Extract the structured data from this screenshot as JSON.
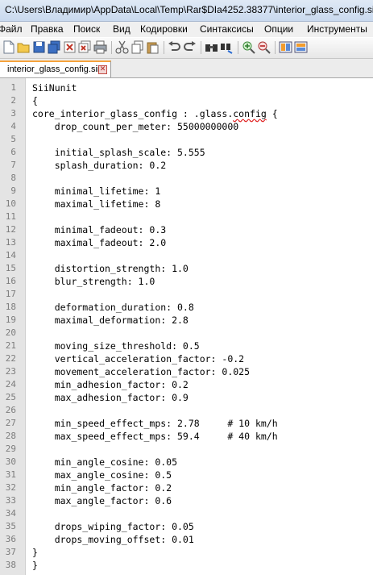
{
  "window": {
    "title": "C:\\Users\\Владимир\\AppData\\Local\\Temp\\Rar$DIa4252.38377\\interior_glass_config.sii"
  },
  "menu": [
    "Файл",
    "Правка",
    "Поиск",
    "Вид",
    "Кодировки",
    "Синтаксисы",
    "Опции",
    "Инструменты"
  ],
  "toolbar": {
    "icons": [
      "new-file-icon",
      "open-file-icon",
      "save-icon",
      "save-all-icon",
      "close-icon",
      "close-all-icon",
      "print-icon",
      "cut-icon",
      "copy-icon",
      "paste-icon",
      "undo-icon",
      "redo-icon",
      "find-icon",
      "replace-icon",
      "zoom-in-icon",
      "zoom-out-icon",
      "sync-v-icon",
      "sync-h-icon"
    ]
  },
  "tab": {
    "label": "interior_glass_config.sii",
    "close_glyph": "✕"
  },
  "editor": {
    "lines": [
      {
        "n": "1",
        "text": "SiiNunit"
      },
      {
        "n": "2",
        "text": "{"
      },
      {
        "n": "3",
        "text": "core_interior_glass_config : .glass.config {"
      },
      {
        "n": "4",
        "text": "    drop_count_per_meter: 55000000000"
      },
      {
        "n": "5",
        "text": ""
      },
      {
        "n": "6",
        "text": "    initial_splash_scale: 5.555"
      },
      {
        "n": "7",
        "text": "    splash_duration: 0.2"
      },
      {
        "n": "8",
        "text": ""
      },
      {
        "n": "9",
        "text": "    minimal_lifetime: 1"
      },
      {
        "n": "10",
        "text": "    maximal_lifetime: 8"
      },
      {
        "n": "11",
        "text": ""
      },
      {
        "n": "12",
        "text": "    minimal_fadeout: 0.3"
      },
      {
        "n": "13",
        "text": "    maximal_fadeout: 2.0"
      },
      {
        "n": "14",
        "text": ""
      },
      {
        "n": "15",
        "text": "    distortion_strength: 1.0"
      },
      {
        "n": "16",
        "text": "    blur_strength: 1.0"
      },
      {
        "n": "17",
        "text": ""
      },
      {
        "n": "18",
        "text": "    deformation_duration: 0.8"
      },
      {
        "n": "19",
        "text": "    maximal_deformation: 2.8"
      },
      {
        "n": "20",
        "text": ""
      },
      {
        "n": "21",
        "text": "    moving_size_threshold: 0.5"
      },
      {
        "n": "22",
        "text": "    vertical_acceleration_factor: -0.2"
      },
      {
        "n": "23",
        "text": "    movement_acceleration_factor: 0.025"
      },
      {
        "n": "24",
        "text": "    min_adhesion_factor: 0.2"
      },
      {
        "n": "25",
        "text": "    max_adhesion_factor: 0.9"
      },
      {
        "n": "26",
        "text": ""
      },
      {
        "n": "27",
        "text": "    min_speed_effect_mps: 2.78     # 10 km/h"
      },
      {
        "n": "28",
        "text": "    max_speed_effect_mps: 59.4     # 40 km/h"
      },
      {
        "n": "29",
        "text": ""
      },
      {
        "n": "30",
        "text": "    min_angle_cosine: 0.05"
      },
      {
        "n": "31",
        "text": "    max_angle_cosine: 0.5"
      },
      {
        "n": "32",
        "text": "    min_angle_factor: 0.2"
      },
      {
        "n": "33",
        "text": "    max_angle_factor: 0.6"
      },
      {
        "n": "34",
        "text": ""
      },
      {
        "n": "35",
        "text": "    drops_wiping_factor: 0.05"
      },
      {
        "n": "36",
        "text": "    drops_moving_offset: 0.01"
      },
      {
        "n": "37",
        "text": "}"
      },
      {
        "n": "38",
        "text": "}"
      }
    ]
  },
  "colors": {
    "tab_accent": "#f6a33c",
    "gutter": "#e4e4e4",
    "line_number": "#7c7c7c"
  }
}
